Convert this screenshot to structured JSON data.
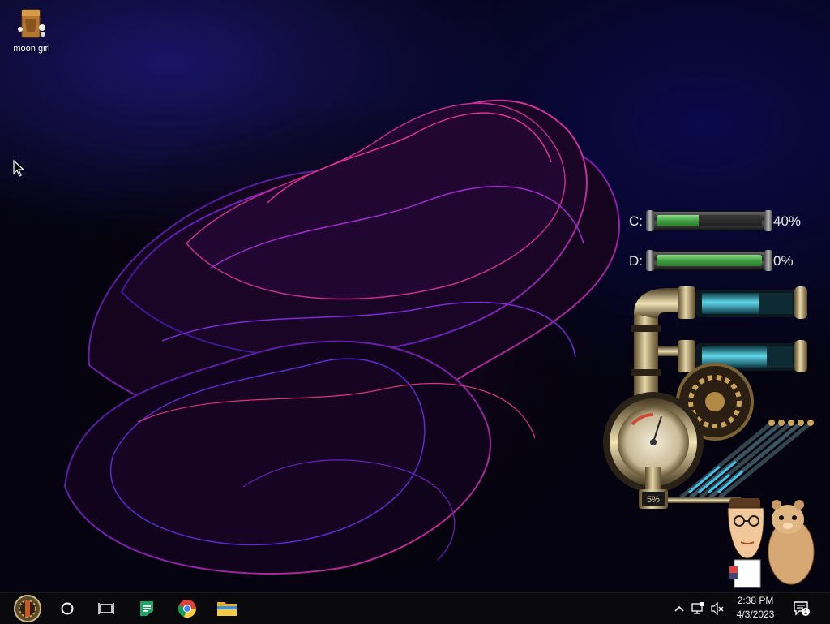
{
  "desktop": {
    "icons": [
      {
        "label": "moon girl",
        "icon": "folder-bag-icon"
      }
    ]
  },
  "drives": [
    {
      "label": "C:",
      "percent_text": "40%",
      "used": 0.4
    },
    {
      "label": "D:",
      "percent_text": "0%",
      "used": 1.0
    }
  ],
  "steam_gauge": {
    "readout": "5%"
  },
  "taskbar": {
    "start_icon": "steampunk-start-orb-icon",
    "search_icon": "cortana-circle-icon",
    "taskview_icon": "task-view-icon",
    "apps": [
      "google-sheets-icon",
      "chrome-icon",
      "file-explorer-icon"
    ],
    "tray": [
      "show-hidden-icons-chevron",
      "network-icon",
      "volume-muted-icon"
    ],
    "clock": {
      "time": "2:38 PM",
      "date": "4/3/2023"
    },
    "notification_count": "1"
  },
  "colors": {
    "accent_purple": "#7a2bd6",
    "accent_pink": "#e0338e",
    "taskbar_bg": "#0a0a0d"
  }
}
